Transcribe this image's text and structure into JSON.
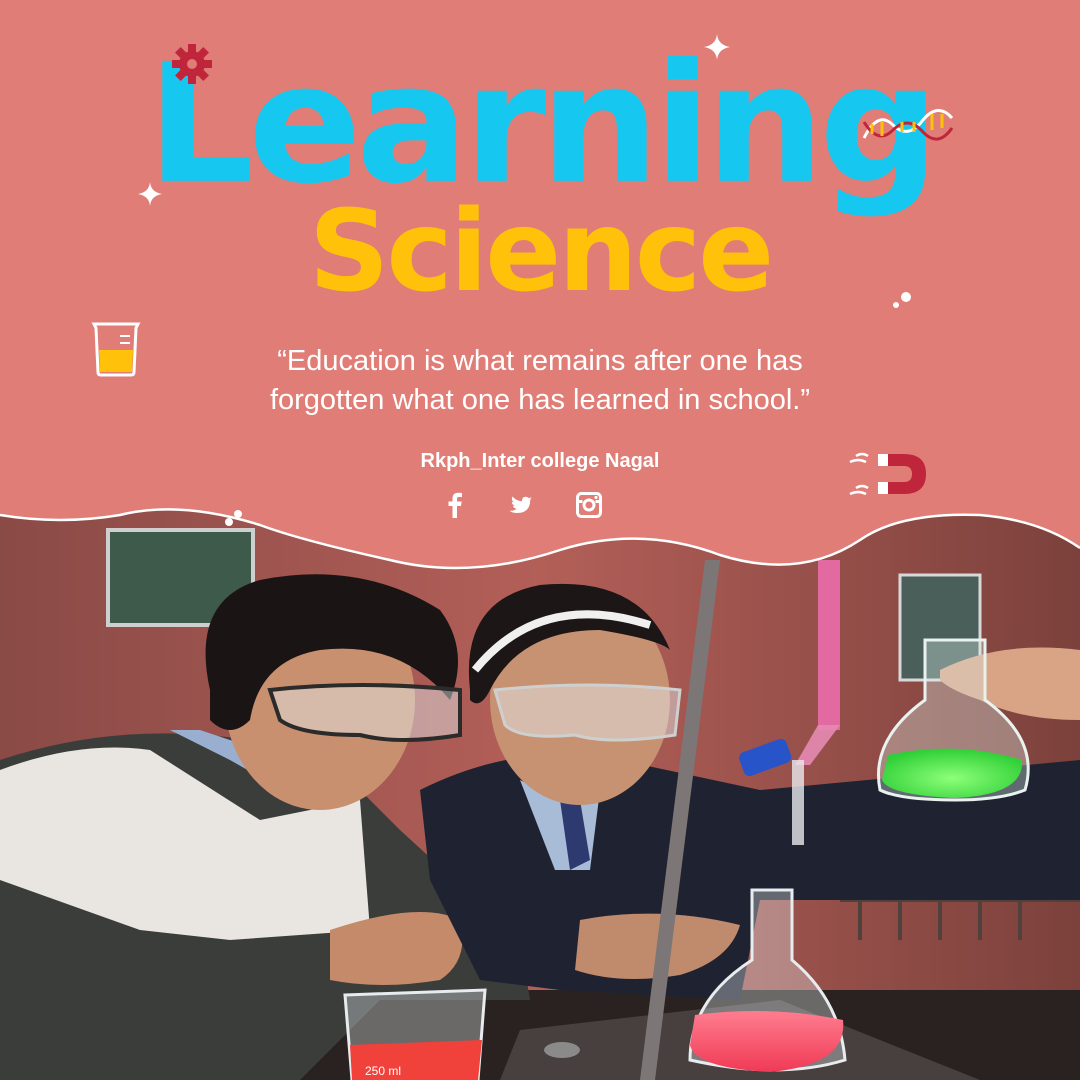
{
  "title": {
    "line1": "Learning",
    "line2": "Science"
  },
  "quote": {
    "line1": "“Education is what remains after one has",
    "line2": "forgotten what one has learned in school.”"
  },
  "organization": "Rkph_Inter college Nagal",
  "social_icons": [
    "facebook-icon",
    "twitter-icon",
    "instagram-icon"
  ],
  "photo": {
    "beaker_label": "250 ml"
  },
  "colors": {
    "background": "#e07d76",
    "title_primary": "#16c8f0",
    "title_secondary": "#ffc109",
    "text": "#ffffff",
    "accent": "#c0263b"
  }
}
